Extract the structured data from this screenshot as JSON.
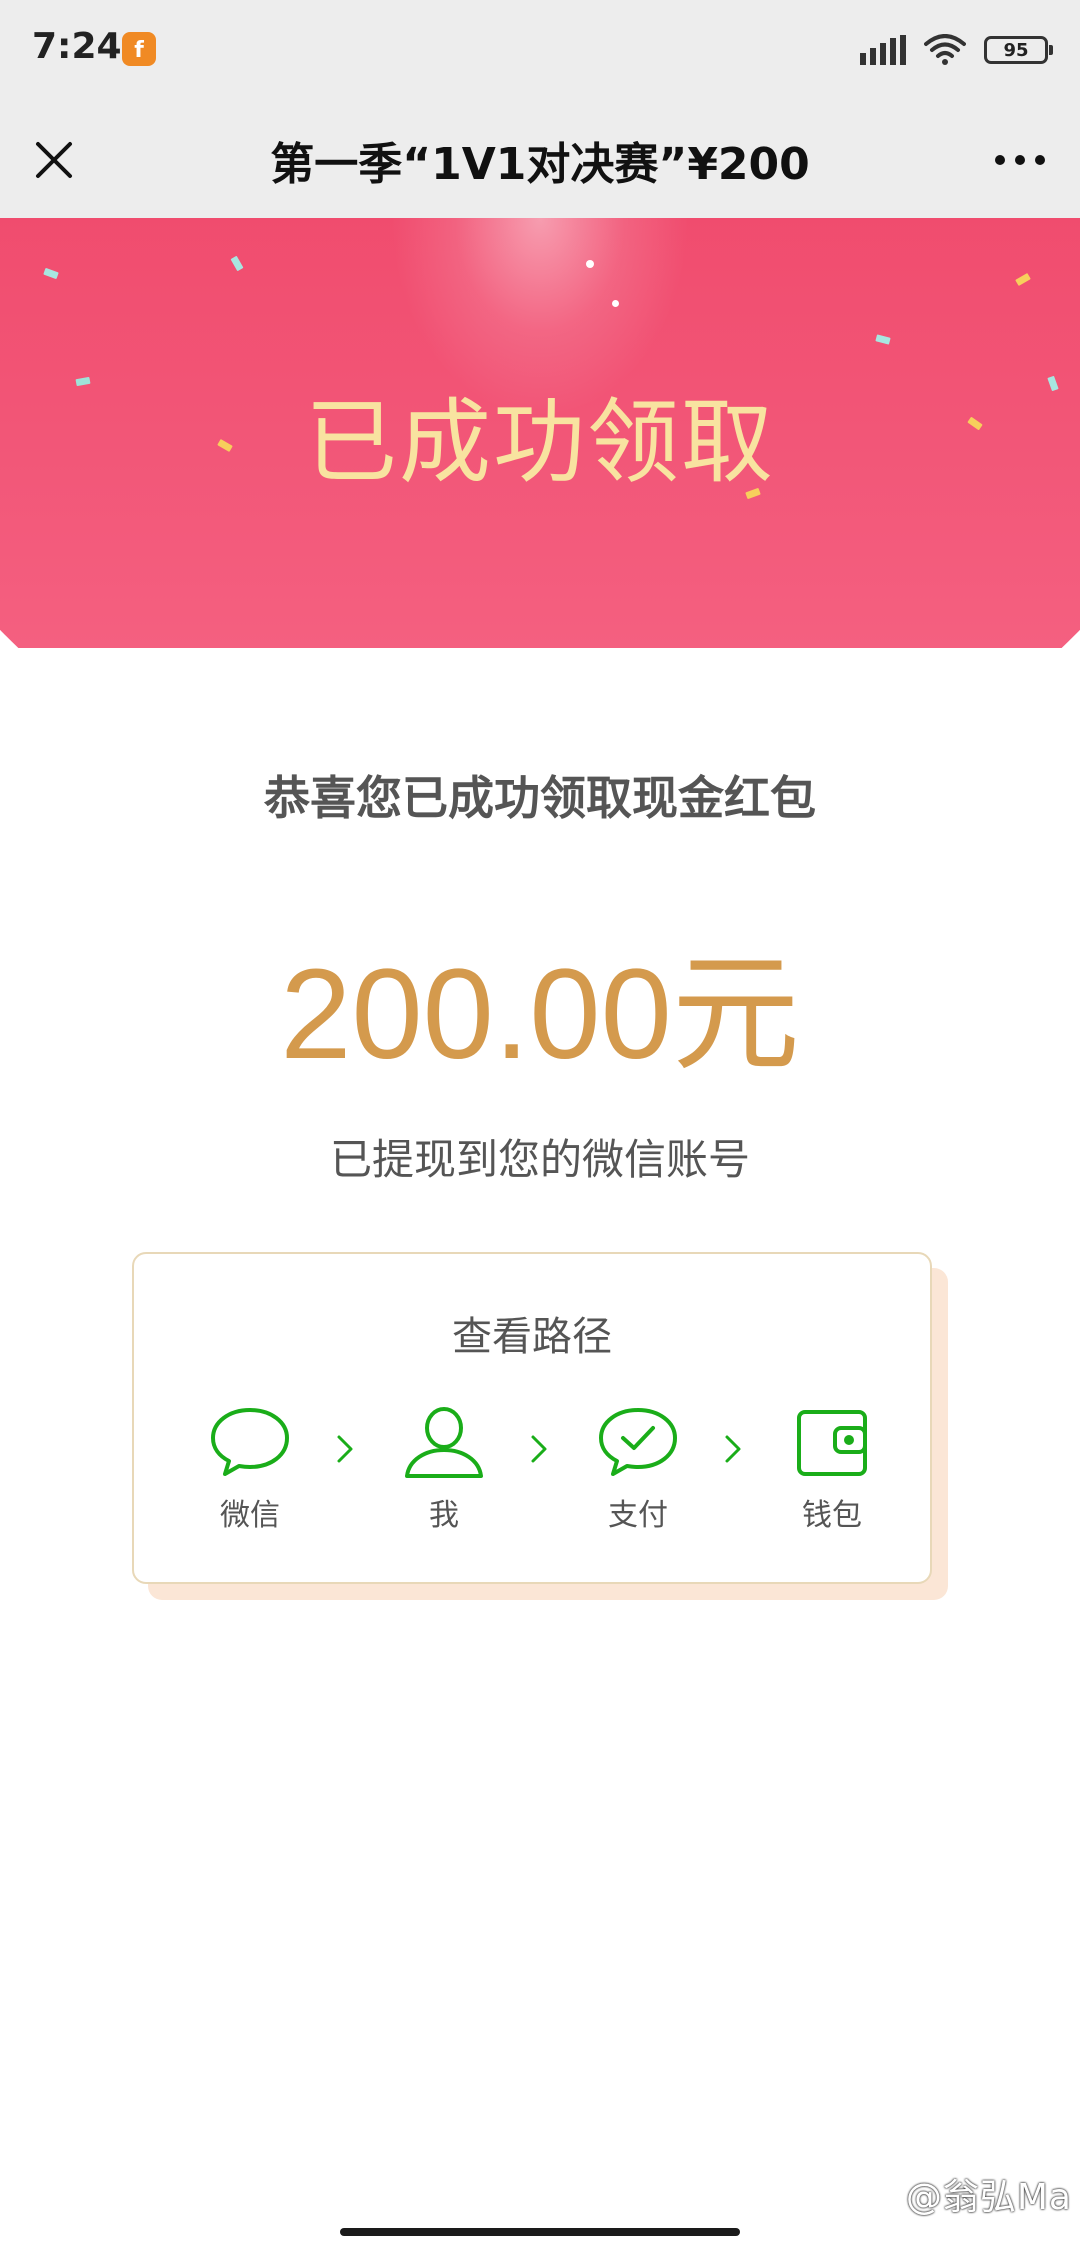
{
  "status_bar": {
    "time": "7:24",
    "app_icon": "f",
    "battery": "95"
  },
  "nav": {
    "title": "第一季“1V1对决赛”¥200",
    "close_icon": "close-icon",
    "more_icon": "more-icon"
  },
  "header": {
    "title": "已成功领取",
    "color_start": "#f04a6c",
    "color_end": "#f76a88",
    "title_color": "#f8e3a0"
  },
  "main": {
    "congrats": "恭喜您已成功领取现金红包",
    "amount": "200.00元",
    "amount_color": "#d49a4d",
    "withdrawn": "已提现到您的微信账号"
  },
  "path_card": {
    "title": "查看路径",
    "steps": [
      {
        "label": "微信",
        "icon": "chat-bubble-icon"
      },
      {
        "label": "我",
        "icon": "person-icon"
      },
      {
        "label": "支付",
        "icon": "pay-check-icon"
      },
      {
        "label": "钱包",
        "icon": "wallet-icon"
      }
    ],
    "accent": "#1aad19"
  },
  "watermark": "@翁弘Ma"
}
